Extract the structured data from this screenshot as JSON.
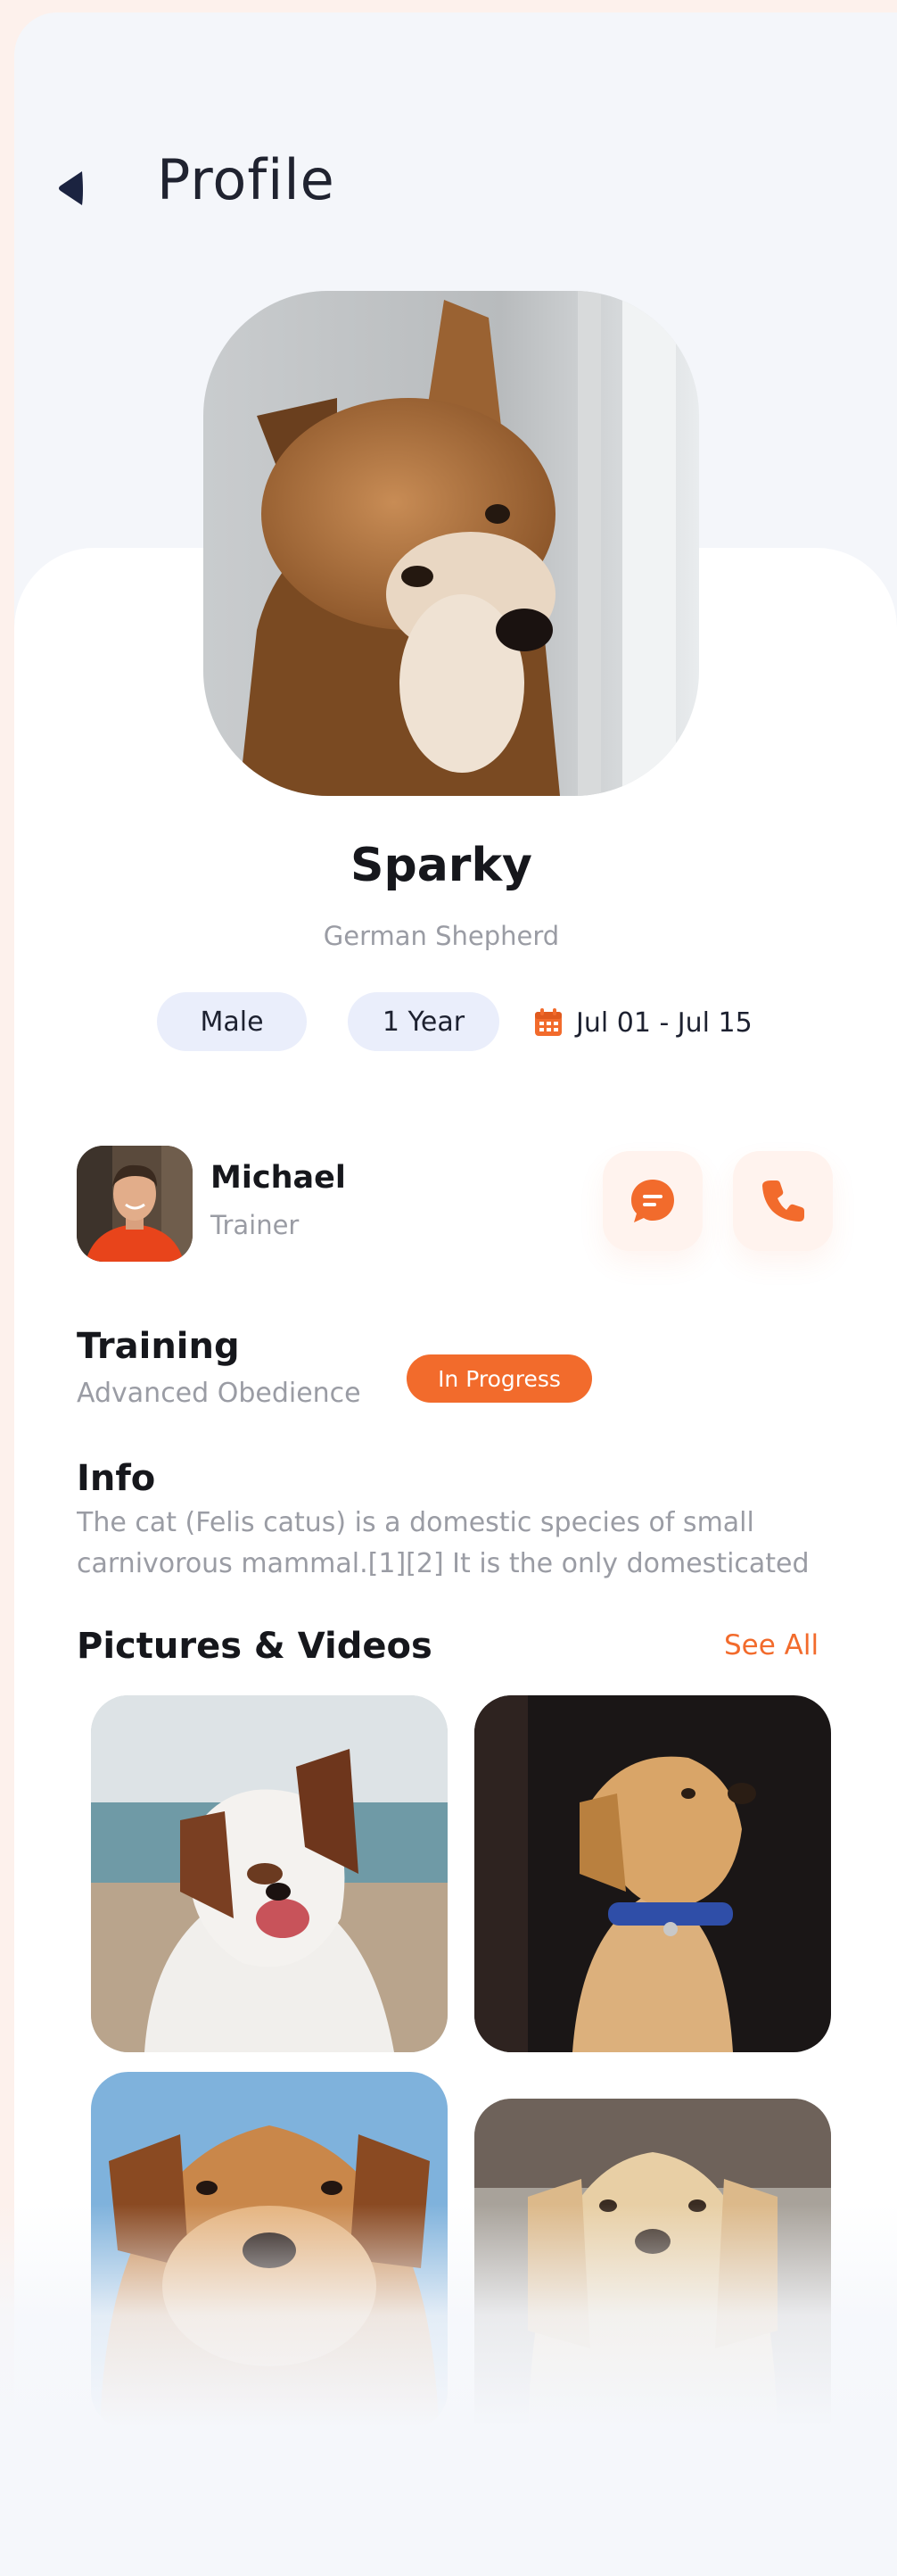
{
  "header": {
    "title": "Profile"
  },
  "pet": {
    "name": "Sparky",
    "breed": "German Shepherd",
    "gender": "Male",
    "age": "1 Year",
    "dates": "Jul 01 - Jul 15"
  },
  "trainer": {
    "name": "Michael",
    "role": "Trainer"
  },
  "training": {
    "title": "Training",
    "program": "Advanced Obedience",
    "status": "In Progress"
  },
  "info": {
    "title": "Info",
    "body": "The cat (Felis catus) is a domestic species of small carnivorous mammal.[1][2] It is the only domesticated"
  },
  "media": {
    "title": "Pictures & Videos",
    "see_all": "See All"
  },
  "colors": {
    "accent": "#f26b2c",
    "chip_bg": "#eaeefb",
    "text_dark": "#16171c",
    "text_muted": "#9a9ca4"
  },
  "icons": [
    "back-arrow-icon",
    "calendar-icon",
    "chat-icon",
    "phone-icon"
  ]
}
